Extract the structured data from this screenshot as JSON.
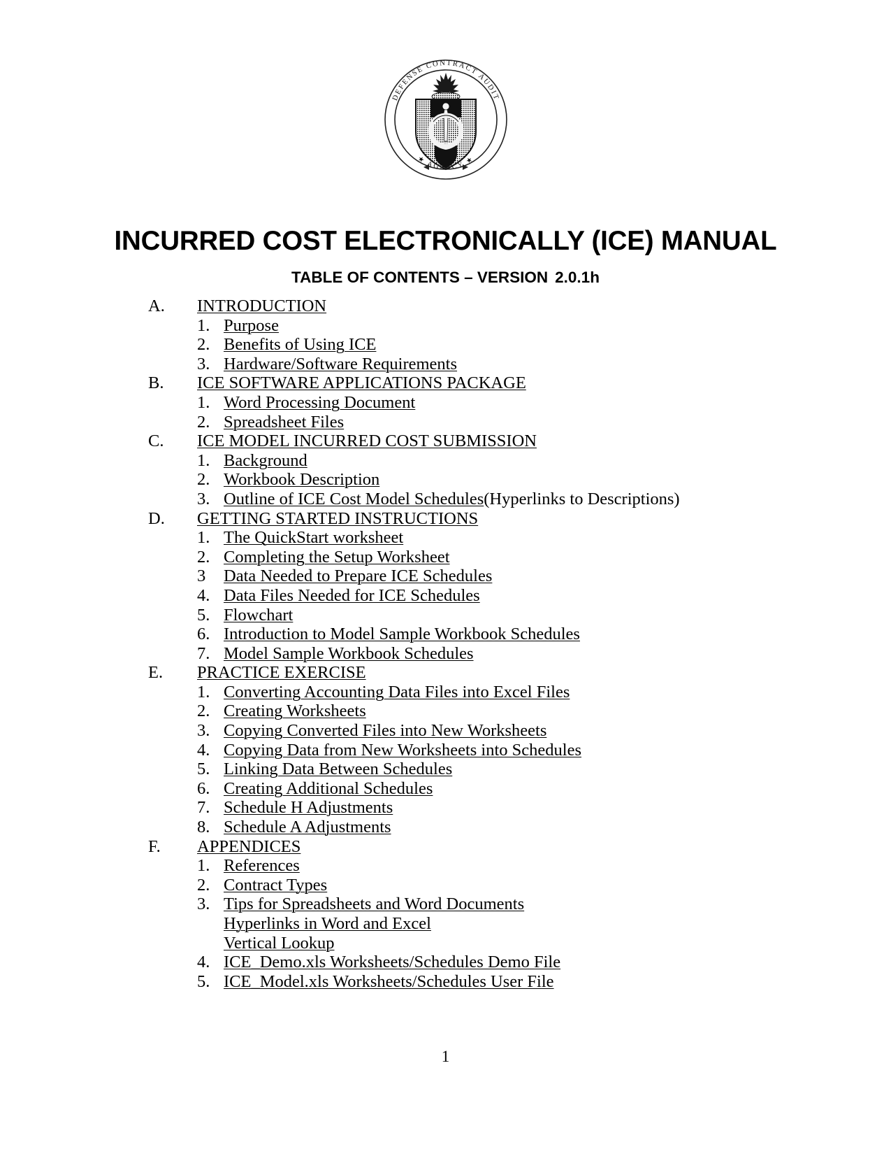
{
  "document": {
    "seal_name": "dcaa-seal",
    "seal_outer_text": "DEFENSE CONTRACT AUDIT AGENCY",
    "title": "INCURRED COST ELECTRONICALLY (ICE) MANUAL",
    "subtitle_prefix": "TABLE OF CONTENTS – VERSION",
    "subtitle_version": "2.0.1h",
    "page_number": "1"
  },
  "toc": {
    "sections": [
      {
        "marker": "A.",
        "title": "INTRODUCTION",
        "items": [
          {
            "marker": "1.",
            "text": "Purpose"
          },
          {
            "marker": "2.",
            "text": "Benefits of Using ICE"
          },
          {
            "marker": "3.",
            "text": "Hardware/Software Requirements"
          }
        ]
      },
      {
        "marker": "B.",
        "title": "ICE SOFTWARE APPLICATIONS PACKAGE",
        "items": [
          {
            "marker": "1.",
            "text": "Word Processing Document"
          },
          {
            "marker": "2.",
            "text": "Spreadsheet Files"
          }
        ]
      },
      {
        "marker": "C.",
        "title": "ICE MODEL INCURRED COST SUBMISSION",
        "items": [
          {
            "marker": "1.",
            "text": "Background"
          },
          {
            "marker": "2.",
            "text": "Workbook Description"
          },
          {
            "marker": "3.",
            "text": "Outline of ICE Cost Model Schedules",
            "suffix": " (Hyperlinks to Descriptions)"
          }
        ]
      },
      {
        "marker": "D.",
        "title": "GETTING STARTED INSTRUCTIONS",
        "items": [
          {
            "marker": "1.",
            "text": "The QuickStart worksheet"
          },
          {
            "marker": "2.",
            "text": "Completing the Setup Worksheet"
          },
          {
            "marker": "3",
            "text": "Data Needed to Prepare ICE Schedules"
          },
          {
            "marker": "4.",
            "text": "Data Files Needed for ICE Schedules"
          },
          {
            "marker": "5.",
            "text": "Flowchart"
          },
          {
            "marker": "6.",
            "text": "Introduction to Model Sample Workbook Schedules"
          },
          {
            "marker": "7.",
            "text": "Model Sample Workbook Schedules"
          }
        ]
      },
      {
        "marker": "E.",
        "title": "PRACTICE EXERCISE",
        "items": [
          {
            "marker": "1.",
            "text": "Converting Accounting Data Files into Excel Files"
          },
          {
            "marker": "2.",
            "text": "Creating Worksheets"
          },
          {
            "marker": "3.",
            "text": "Copying Converted Files into New Worksheets"
          },
          {
            "marker": "4.",
            "text": "Copying Data from New Worksheets into Schedules"
          },
          {
            "marker": "5.",
            "text": "Linking Data Between Schedules"
          },
          {
            "marker": "6.",
            "text": "Creating Additional Schedules"
          },
          {
            "marker": "7.",
            "text": "Schedule H Adjustments"
          },
          {
            "marker": "8.",
            "text": "Schedule A Adjustments"
          }
        ]
      },
      {
        "marker": "F.",
        "title": "APPENDICES",
        "items": [
          {
            "marker": "1.",
            "text": "References"
          },
          {
            "marker": "2.",
            "text": "Contract Types"
          },
          {
            "marker": "3.",
            "text": "Tips for Spreadsheets and Word Documents"
          },
          {
            "marker": "",
            "text": "Hyperlinks in Word and Excel"
          },
          {
            "marker": "",
            "text": "Vertical Lookup"
          },
          {
            "marker": "4.",
            "text": "ICE_Demo.xls Worksheets/Schedules Demo File"
          },
          {
            "marker": "5.",
            "text": "ICE_Model.xls Worksheets/Schedules User File"
          }
        ]
      }
    ]
  }
}
